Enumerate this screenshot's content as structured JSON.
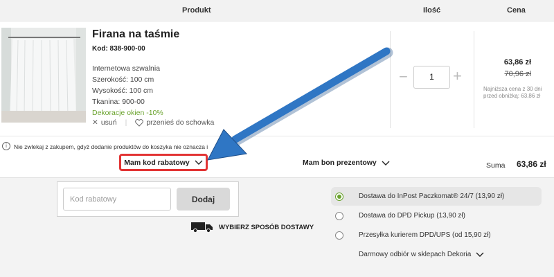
{
  "header": {
    "col_product": "Produkt",
    "col_qty": "Ilość",
    "col_price": "Cena"
  },
  "product": {
    "title": "Firana na taśmie",
    "code": "Kod: 838-900-00",
    "attrs": [
      "Internetowa szwalnia",
      "Szerokość: 100 cm",
      "Wysokość: 100 cm",
      "Tkanina: 900-00"
    ],
    "promo": "Dekoracje okien -10%",
    "remove_label": "usuń",
    "save_label": "przenieś do schowka"
  },
  "quantity": {
    "value": "1",
    "minus": "−",
    "plus": "+"
  },
  "price": {
    "current": "63,86 zł",
    "old": "70,96 zł",
    "lowest_note": "Najniższa cena z 30 dni przed obniżką: 63,86 zł"
  },
  "info": {
    "text": "Nie zwlekaj z zakupem, gdyż dodanie produktów do koszyka nie oznacza i",
    "text_tail": "j."
  },
  "discount": {
    "label": "Mam kod rabatowy",
    "input_placeholder": "Kod rabatowy",
    "add_label": "Dodaj"
  },
  "voucher": {
    "label": "Mam bon prezentowy"
  },
  "summary": {
    "label": "Suma",
    "value": "63,86 zł"
  },
  "shipping": {
    "heading": "WYBIERZ SPOSÓB DOSTAWY",
    "options": [
      {
        "label": "Dostawa do InPost Paczkomat® 24/7 (13,90 zł)",
        "selected": true
      },
      {
        "label": "Dostawa do DPD Pickup (13,90 zł)",
        "selected": false
      },
      {
        "label": "Przesyłka kurierem DPD/UPS (od 15,90 zł)",
        "selected": false
      }
    ],
    "free_pickup": "Darmowy odbiór w sklepach Dekoria"
  },
  "colors": {
    "accent_green": "#6aa32d",
    "highlight_red": "#e23434",
    "arrow_blue": "#2f76c4"
  }
}
